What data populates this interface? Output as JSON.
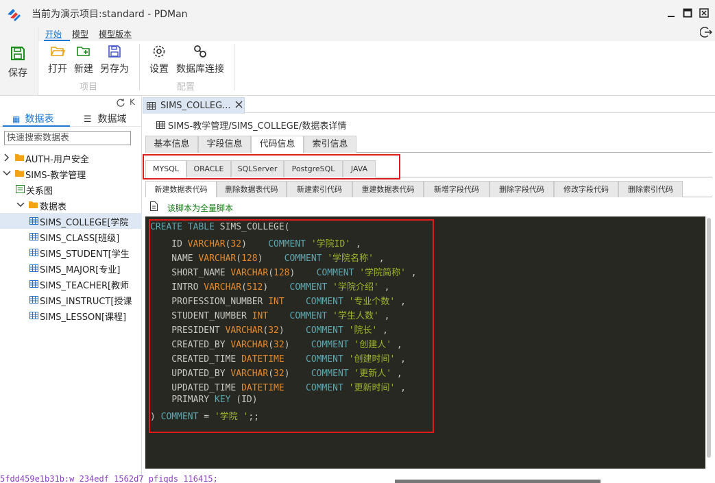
{
  "window": {
    "title": "当前为演示项目:standard - PDMan"
  },
  "ribbon": {
    "save_label": "保存",
    "menu_tabs": [
      "开始",
      "模型",
      "模型版本"
    ],
    "buttons": {
      "open": "打开",
      "new": "新建",
      "save_as": "另存为",
      "settings": "设置",
      "db_connect": "数据库连接"
    },
    "groups": {
      "project": "项目",
      "config": "配置"
    }
  },
  "sidebar": {
    "k_label": "K",
    "tabs": [
      "数据表",
      "数据域"
    ],
    "search_placeholder": "快速搜索数据表",
    "tree": [
      {
        "label": "AUTH-用户安全"
      },
      {
        "label": "SIMS-教学管理"
      },
      {
        "label": "关系图"
      },
      {
        "label": "数据表"
      },
      {
        "label": "SIMS_COLLEGE[学院"
      },
      {
        "label": "SIMS_CLASS[班级]"
      },
      {
        "label": "SIMS_STUDENT[学生"
      },
      {
        "label": "SIMS_MAJOR[专业]"
      },
      {
        "label": "SIMS_TEACHER[教师"
      },
      {
        "label": "SIMS_INSTRUCT[授课"
      },
      {
        "label": "SIMS_LESSON[课程]"
      }
    ]
  },
  "main": {
    "doc_tab": "SIMS_COLLEG...",
    "breadcrumb": "SIMS-教学管理/SIMS_COLLEGE/数据表详情",
    "detail_tabs": [
      "基本信息",
      "字段信息",
      "代码信息",
      "索引信息"
    ],
    "db_tabs": [
      "MYSQL",
      "ORACLE",
      "SQLServer",
      "PostgreSQL",
      "JAVA"
    ],
    "code_tabs": [
      "新建数据表代码",
      "删除数据表代码",
      "新建索引代码",
      "重建数据表代码",
      "新增字段代码",
      "删除字段代码",
      "修改字段代码",
      "删除索引代码"
    ],
    "note": "该脚本为全量脚本"
  },
  "code": {
    "create_kw": "CREATE TABLE",
    "table_name": "SIMS_COLLEGE(",
    "comment_kw": "COMMENT",
    "fields": [
      {
        "name": "ID",
        "type": "VARCHAR",
        "len": "32",
        "comment": "'学院ID'"
      },
      {
        "name": "NAME",
        "type": "VARCHAR",
        "len": "128",
        "comment": "'学院名称'"
      },
      {
        "name": "SHORT_NAME",
        "type": "VARCHAR",
        "len": "128",
        "comment": "'学院简称'"
      },
      {
        "name": "INTRO",
        "type": "VARCHAR",
        "len": "512",
        "comment": "'学院介绍'"
      },
      {
        "name": "PROFESSION_NUMBER",
        "type": "INT",
        "len": "",
        "comment": "'专业个数'"
      },
      {
        "name": "STUDENT_NUMBER",
        "type": "INT",
        "len": "",
        "comment": "'学生人数'"
      },
      {
        "name": "PRESIDENT",
        "type": "VARCHAR",
        "len": "32",
        "comment": "'院长'"
      },
      {
        "name": "CREATED_BY",
        "type": "VARCHAR",
        "len": "32",
        "comment": "'创建人'"
      },
      {
        "name": "CREATED_TIME",
        "type": "DATETIME",
        "len": "",
        "comment": "'创建时间'"
      },
      {
        "name": "UPDATED_BY",
        "type": "VARCHAR",
        "len": "32",
        "comment": "'更新人'"
      },
      {
        "name": "UPDATED_TIME",
        "type": "DATETIME",
        "len": "",
        "comment": "'更新时间'"
      }
    ],
    "primary_line": "PRIMARY KEY (ID)",
    "primary_kw": "PRIMARY",
    "key_kw": "KEY",
    "pk_col": "(ID)",
    "closing": ") COMMENT = '学院 ';;",
    "closing_comment": "'学院 '"
  },
  "bottom": {
    "text": "5fdd459e1b31b:w 234edf 1562d7 pfiqds 116415;"
  },
  "colors": {
    "accent": "#1976d2",
    "highlight": "#e01b1b",
    "code_bg": "#272822"
  }
}
